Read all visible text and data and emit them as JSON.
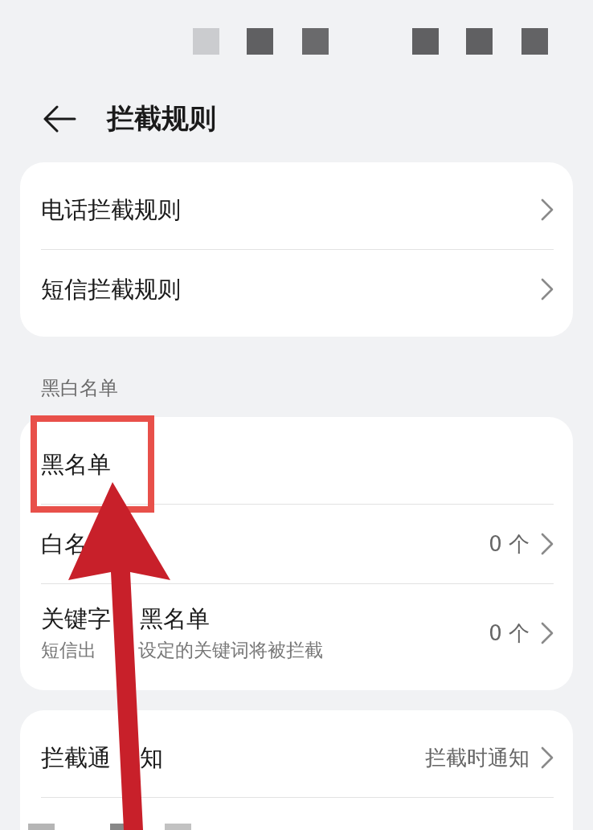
{
  "header": {
    "title": "拦截规则"
  },
  "groups": [
    {
      "items": [
        {
          "title": "电话拦截规则",
          "chevron": true
        },
        {
          "title": "短信拦截规则",
          "chevron": true
        }
      ]
    },
    {
      "heading": "黑白名单",
      "items": [
        {
          "title": "黑名单",
          "chevron": false
        },
        {
          "title": "白名",
          "value": "0 个",
          "chevron": true
        },
        {
          "title_parts": [
            "关键字",
            "黑名单"
          ],
          "subtitle_parts": [
            "短信出",
            "设定的关键词将被拦截"
          ],
          "value": "0 个",
          "chevron": true
        }
      ]
    },
    {
      "items": [
        {
          "title_parts": [
            "拦截通",
            "知"
          ],
          "value": "拦截时通知",
          "chevron": true
        }
      ]
    }
  ]
}
